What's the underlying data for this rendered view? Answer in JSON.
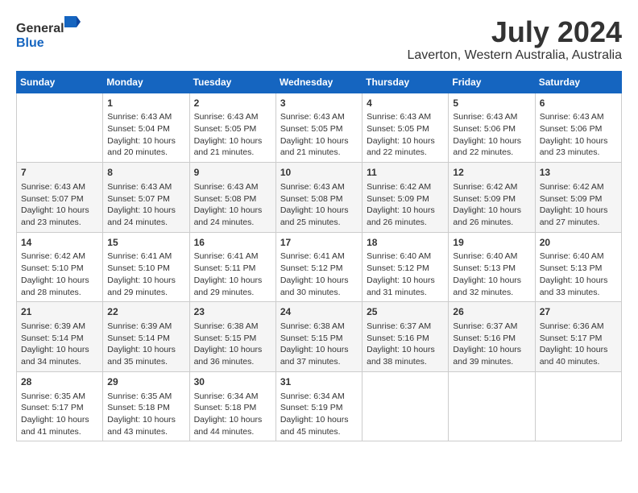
{
  "header": {
    "logo_general": "General",
    "logo_blue": "Blue",
    "month_title": "July 2024",
    "location": "Laverton, Western Australia, Australia"
  },
  "weekdays": [
    "Sunday",
    "Monday",
    "Tuesday",
    "Wednesday",
    "Thursday",
    "Friday",
    "Saturday"
  ],
  "weeks": [
    [
      {
        "day": "",
        "content": ""
      },
      {
        "day": "1",
        "content": "Sunrise: 6:43 AM\nSunset: 5:04 PM\nDaylight: 10 hours\nand 20 minutes."
      },
      {
        "day": "2",
        "content": "Sunrise: 6:43 AM\nSunset: 5:05 PM\nDaylight: 10 hours\nand 21 minutes."
      },
      {
        "day": "3",
        "content": "Sunrise: 6:43 AM\nSunset: 5:05 PM\nDaylight: 10 hours\nand 21 minutes."
      },
      {
        "day": "4",
        "content": "Sunrise: 6:43 AM\nSunset: 5:05 PM\nDaylight: 10 hours\nand 22 minutes."
      },
      {
        "day": "5",
        "content": "Sunrise: 6:43 AM\nSunset: 5:06 PM\nDaylight: 10 hours\nand 22 minutes."
      },
      {
        "day": "6",
        "content": "Sunrise: 6:43 AM\nSunset: 5:06 PM\nDaylight: 10 hours\nand 23 minutes."
      }
    ],
    [
      {
        "day": "7",
        "content": "Sunrise: 6:43 AM\nSunset: 5:07 PM\nDaylight: 10 hours\nand 23 minutes."
      },
      {
        "day": "8",
        "content": "Sunrise: 6:43 AM\nSunset: 5:07 PM\nDaylight: 10 hours\nand 24 minutes."
      },
      {
        "day": "9",
        "content": "Sunrise: 6:43 AM\nSunset: 5:08 PM\nDaylight: 10 hours\nand 24 minutes."
      },
      {
        "day": "10",
        "content": "Sunrise: 6:43 AM\nSunset: 5:08 PM\nDaylight: 10 hours\nand 25 minutes."
      },
      {
        "day": "11",
        "content": "Sunrise: 6:42 AM\nSunset: 5:09 PM\nDaylight: 10 hours\nand 26 minutes."
      },
      {
        "day": "12",
        "content": "Sunrise: 6:42 AM\nSunset: 5:09 PM\nDaylight: 10 hours\nand 26 minutes."
      },
      {
        "day": "13",
        "content": "Sunrise: 6:42 AM\nSunset: 5:09 PM\nDaylight: 10 hours\nand 27 minutes."
      }
    ],
    [
      {
        "day": "14",
        "content": "Sunrise: 6:42 AM\nSunset: 5:10 PM\nDaylight: 10 hours\nand 28 minutes."
      },
      {
        "day": "15",
        "content": "Sunrise: 6:41 AM\nSunset: 5:10 PM\nDaylight: 10 hours\nand 29 minutes."
      },
      {
        "day": "16",
        "content": "Sunrise: 6:41 AM\nSunset: 5:11 PM\nDaylight: 10 hours\nand 29 minutes."
      },
      {
        "day": "17",
        "content": "Sunrise: 6:41 AM\nSunset: 5:12 PM\nDaylight: 10 hours\nand 30 minutes."
      },
      {
        "day": "18",
        "content": "Sunrise: 6:40 AM\nSunset: 5:12 PM\nDaylight: 10 hours\nand 31 minutes."
      },
      {
        "day": "19",
        "content": "Sunrise: 6:40 AM\nSunset: 5:13 PM\nDaylight: 10 hours\nand 32 minutes."
      },
      {
        "day": "20",
        "content": "Sunrise: 6:40 AM\nSunset: 5:13 PM\nDaylight: 10 hours\nand 33 minutes."
      }
    ],
    [
      {
        "day": "21",
        "content": "Sunrise: 6:39 AM\nSunset: 5:14 PM\nDaylight: 10 hours\nand 34 minutes."
      },
      {
        "day": "22",
        "content": "Sunrise: 6:39 AM\nSunset: 5:14 PM\nDaylight: 10 hours\nand 35 minutes."
      },
      {
        "day": "23",
        "content": "Sunrise: 6:38 AM\nSunset: 5:15 PM\nDaylight: 10 hours\nand 36 minutes."
      },
      {
        "day": "24",
        "content": "Sunrise: 6:38 AM\nSunset: 5:15 PM\nDaylight: 10 hours\nand 37 minutes."
      },
      {
        "day": "25",
        "content": "Sunrise: 6:37 AM\nSunset: 5:16 PM\nDaylight: 10 hours\nand 38 minutes."
      },
      {
        "day": "26",
        "content": "Sunrise: 6:37 AM\nSunset: 5:16 PM\nDaylight: 10 hours\nand 39 minutes."
      },
      {
        "day": "27",
        "content": "Sunrise: 6:36 AM\nSunset: 5:17 PM\nDaylight: 10 hours\nand 40 minutes."
      }
    ],
    [
      {
        "day": "28",
        "content": "Sunrise: 6:35 AM\nSunset: 5:17 PM\nDaylight: 10 hours\nand 41 minutes."
      },
      {
        "day": "29",
        "content": "Sunrise: 6:35 AM\nSunset: 5:18 PM\nDaylight: 10 hours\nand 43 minutes."
      },
      {
        "day": "30",
        "content": "Sunrise: 6:34 AM\nSunset: 5:18 PM\nDaylight: 10 hours\nand 44 minutes."
      },
      {
        "day": "31",
        "content": "Sunrise: 6:34 AM\nSunset: 5:19 PM\nDaylight: 10 hours\nand 45 minutes."
      },
      {
        "day": "",
        "content": ""
      },
      {
        "day": "",
        "content": ""
      },
      {
        "day": "",
        "content": ""
      }
    ]
  ]
}
